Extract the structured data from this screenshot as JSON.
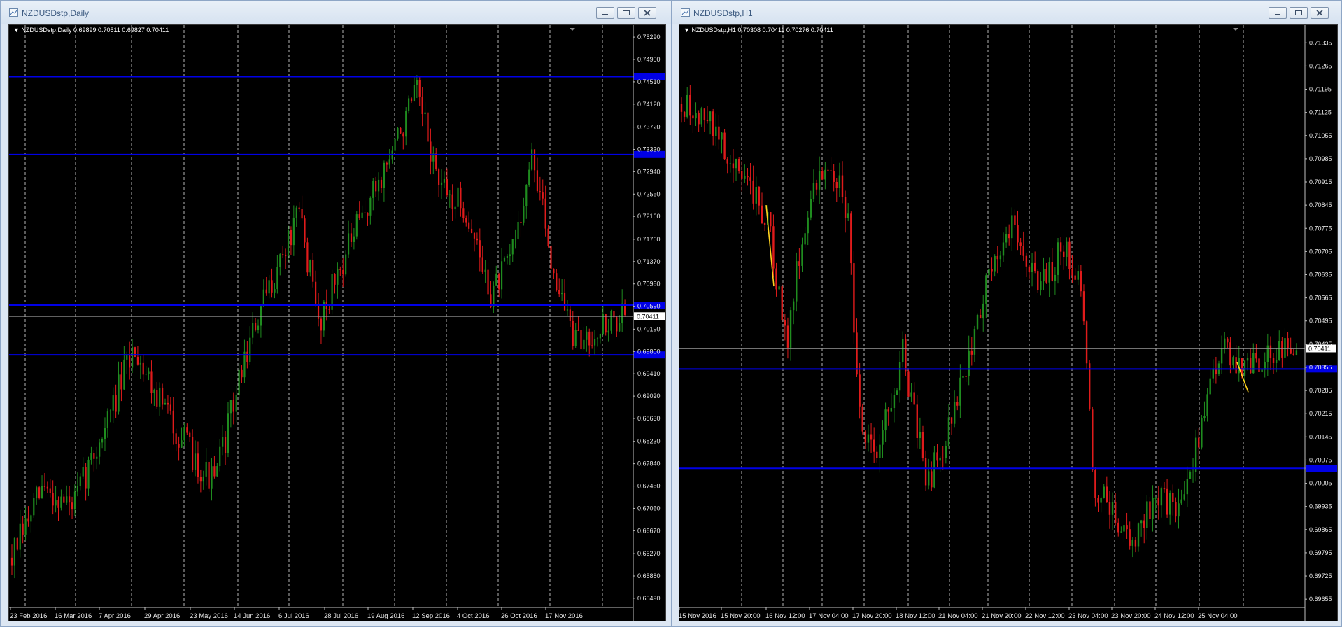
{
  "left": {
    "title": "NZDUSDstp,Daily",
    "info_symbol": "NZDUSDstp,Daily",
    "info_values": "0.69899 0.70511 0.69827 0.70411",
    "price_labels": [
      "0.75290",
      "0.74900",
      "0.74510",
      "0.74120",
      "0.73720",
      "0.73330",
      "0.72940",
      "0.72550",
      "0.72160",
      "0.71760",
      "0.71370",
      "0.70980",
      "0.70590",
      "0.70411",
      "0.70190",
      "0.69800",
      "0.69410",
      "0.69020",
      "0.68630",
      "0.68230",
      "0.67840",
      "0.67450",
      "0.67060",
      "0.66670",
      "0.66270",
      "0.65880",
      "0.65490"
    ],
    "date_labels": [
      "23 Feb 2016",
      "16 Mar 2016",
      "7 Apr 2016",
      "29 Apr 2016",
      "23 May 2016",
      "14 Jun 2016",
      "6 Jul 2016",
      "28 Jul 2016",
      "19 Aug 2016",
      "12 Sep 2016",
      "4 Oct 2016",
      "26 Oct 2016",
      "17 Nov 2016"
    ],
    "current_price": "0.70411",
    "horizontal_levels": [
      0.746,
      0.7324,
      0.7061,
      0.6974
    ]
  },
  "right": {
    "title": "NZDUSDstp,H1",
    "info_symbol": "NZDUSDstp,H1",
    "info_values": "0.70308 0.70411 0.70276 0.70411",
    "price_labels": [
      "0.71335",
      "0.71265",
      "0.71195",
      "0.71125",
      "0.71055",
      "0.70985",
      "0.70915",
      "0.70845",
      "0.70775",
      "0.70705",
      "0.70635",
      "0.70565",
      "0.70495",
      "0.70425",
      "0.70411",
      "0.70355",
      "0.70285",
      "0.70215",
      "0.70145",
      "0.70075",
      "0.70005",
      "0.69935",
      "0.69865",
      "0.69795",
      "0.69725",
      "0.69655"
    ],
    "date_labels": [
      "15 Nov 2016",
      "15 Nov 20:00",
      "16 Nov 12:00",
      "17 Nov 04:00",
      "17 Nov 20:00",
      "18 Nov 12:00",
      "21 Nov 04:00",
      "21 Nov 20:00",
      "22 Nov 12:00",
      "23 Nov 04:00",
      "23 Nov 20:00",
      "24 Nov 12:00",
      "25 Nov 04:00"
    ],
    "current_price": "0.70411",
    "horizontal_levels": [
      0.7035,
      0.7005
    ]
  },
  "colors": {
    "background": "#000000",
    "bull": "#1f8c1f",
    "bear": "#e01b1b",
    "level_line": "#0000e6",
    "grid": "#c8c8c8",
    "trendline": "#ffd21e"
  }
}
